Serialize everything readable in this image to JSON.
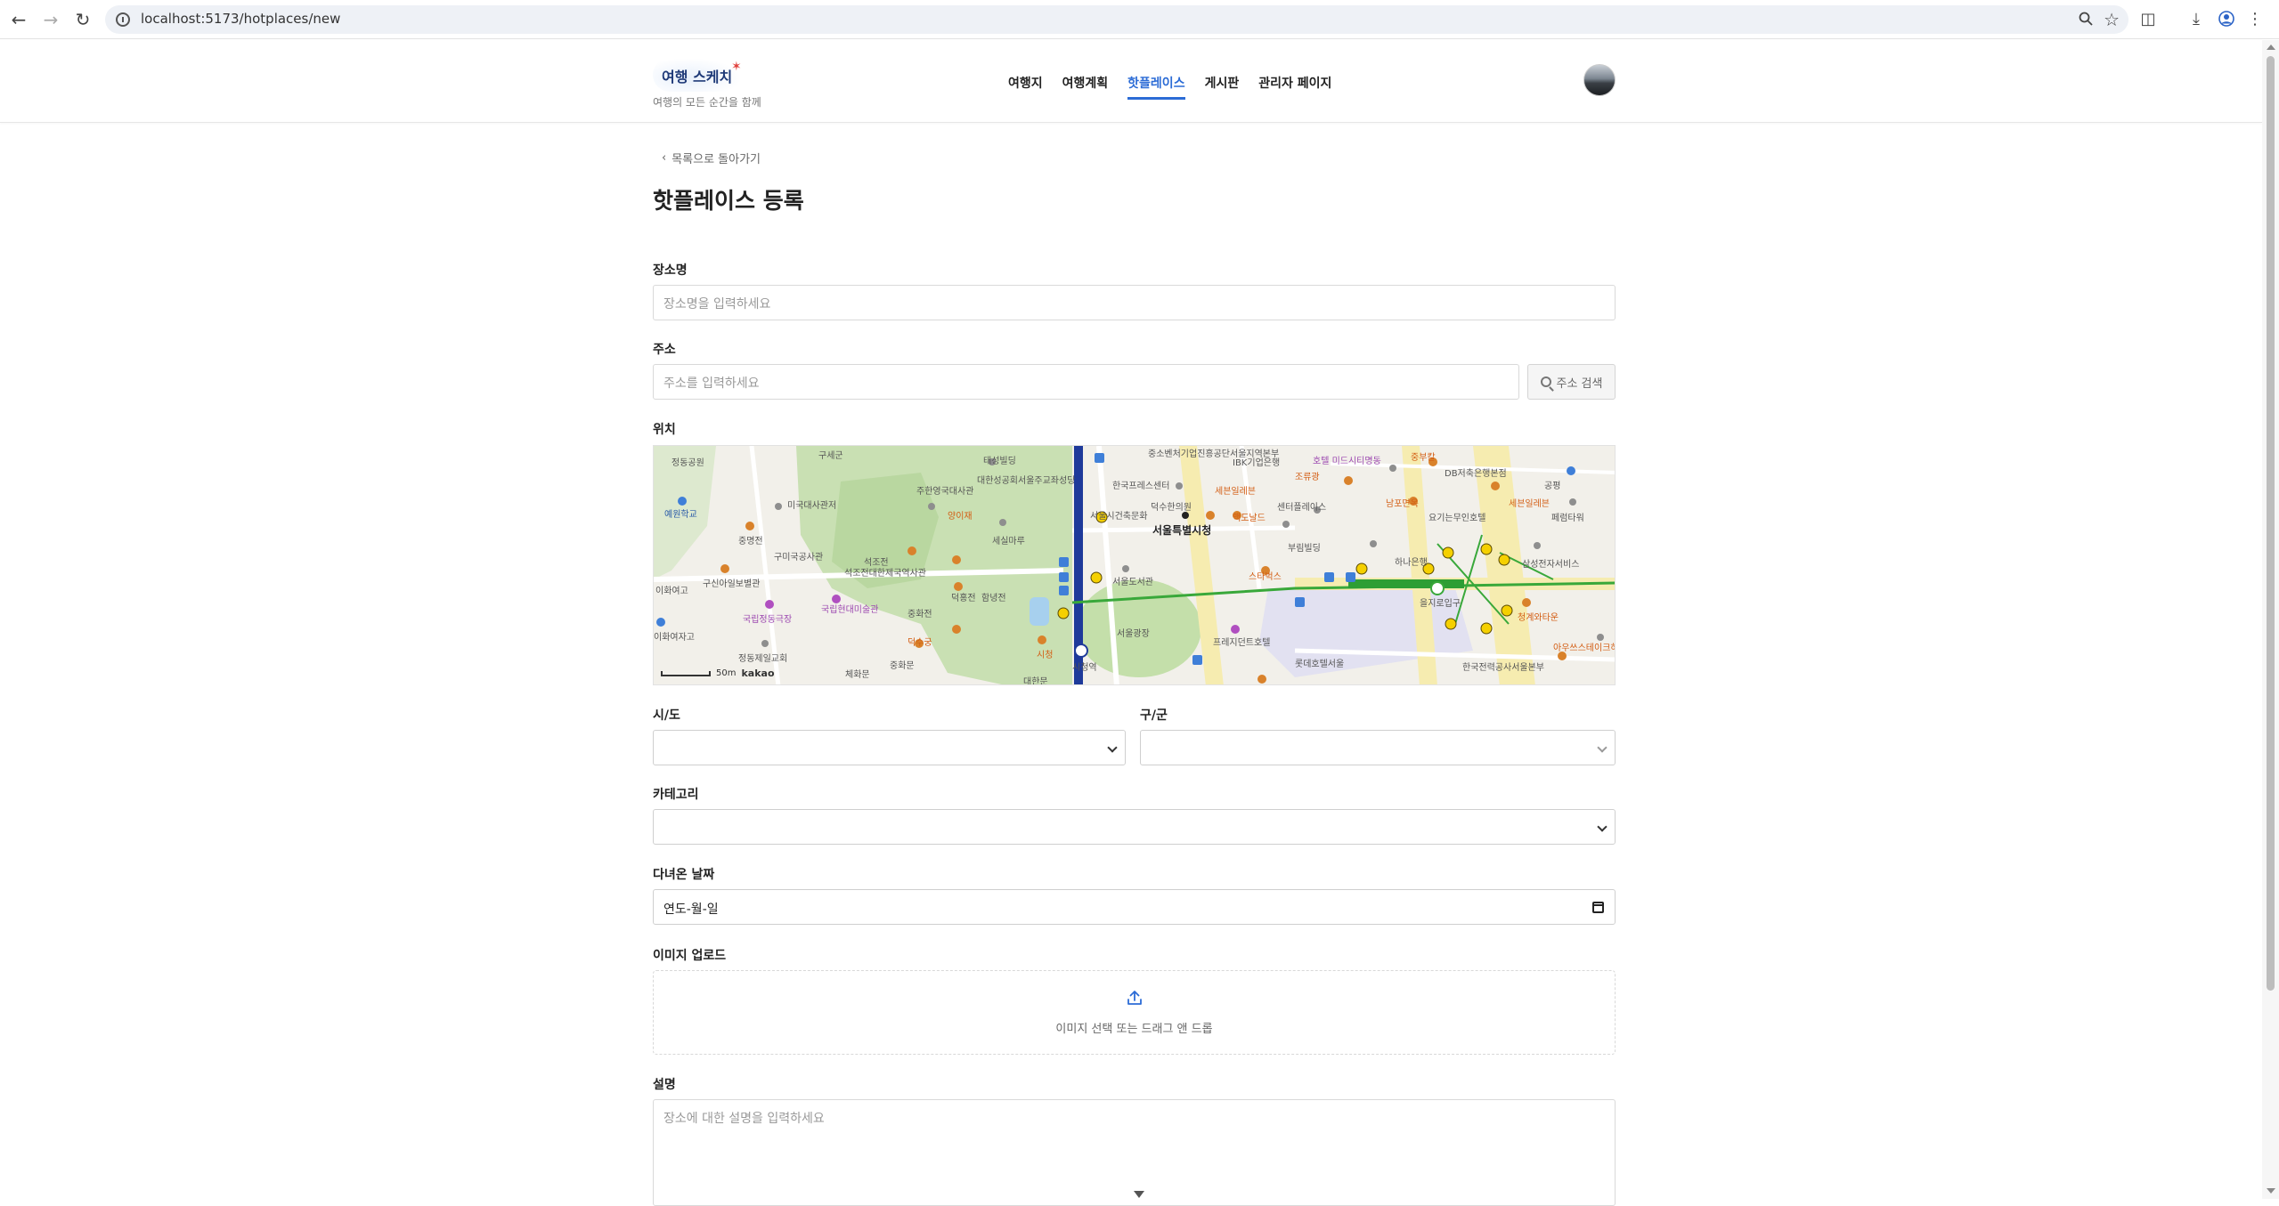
{
  "browser": {
    "url": "localhost:5173/hotplaces/new"
  },
  "site": {
    "logo_text": "여행 스케치",
    "tagline": "여행의 모든 순간을 함께",
    "nav": [
      {
        "label": "여행지",
        "active": false
      },
      {
        "label": "여행계획",
        "active": false
      },
      {
        "label": "핫플레이스",
        "active": true
      },
      {
        "label": "게시판",
        "active": false
      },
      {
        "label": "관리자 페이지",
        "active": false
      }
    ],
    "accent_color": "#2c6cd6"
  },
  "page": {
    "back_link": "목록으로 돌아가기",
    "title": "핫플레이스 등록"
  },
  "form": {
    "name": {
      "label": "장소명",
      "placeholder": "장소명을 입력하세요"
    },
    "address": {
      "label": "주소",
      "placeholder": "주소를 입력하세요",
      "button": "주소 검색"
    },
    "location": {
      "label": "위치"
    },
    "sido": {
      "label": "시/도",
      "value": ""
    },
    "gugun": {
      "label": "구/군",
      "value": ""
    },
    "category": {
      "label": "카테고리",
      "value": ""
    },
    "visit_date": {
      "label": "다녀온 날짜",
      "value": "연도-월-일"
    },
    "image": {
      "label": "이미지 업로드",
      "hint": "이미지 선택 또는 드래그 앤 드롭"
    },
    "description": {
      "label": "설명",
      "placeholder": "장소에 대한 설명을 입력하세요"
    }
  },
  "map": {
    "attribution": "kakao",
    "scale_label": "50m",
    "labels": {
      "city_hall": "서울특별시청",
      "l1": "정동공원",
      "l2": "예원학교",
      "l3": "구세군",
      "l4": "중명전",
      "l5": "구미국공사관",
      "l6": "미국대사관저",
      "l7": "주한영국대사관",
      "l8": "대한성공회서울주교좌성당",
      "l9": "태성빌딩",
      "l10": "양이재",
      "l11": "세실마루",
      "l12": "석조전",
      "l13": "석조전대한제국역사관",
      "l14": "국립현대미술관",
      "l15": "덕홍전",
      "l16": "함녕전",
      "l17": "중화전",
      "l18": "덕수궁",
      "l19": "중화문",
      "l20": "서울도서관",
      "l21": "서울광장",
      "l22": "프레지던트호텔",
      "l23": "롯데호텔서울",
      "l24": "한국전력공사서울본부",
      "l25": "하나은행",
      "l26": "삼성전자서비스",
      "l27": "청계와타운",
      "l28": "센터플레이스",
      "l29": "부림빌딩",
      "l30": "스타벅스",
      "l31": "세븐일레븐",
      "l32": "맥도날드",
      "l33": "덕수한의원",
      "l34": "IBK기업은행",
      "l35": "DB저축은행본점",
      "l36": "호텔 미드시티명동",
      "l37": "조류광",
      "l38": "남포면옥",
      "l39": "요기는무인호텔",
      "l40": "중부칼",
      "l41": "국립정동극장",
      "l42": "구신아일보별관",
      "l43": "이화여고",
      "l44": "정동제일교회",
      "l45": "대한문",
      "l46": "시청",
      "l47": "을지로입구",
      "l48": "시청역",
      "l49": "아우쓰스테이크하우스",
      "l50": "페럼타워",
      "l51": "서울시건축문화",
      "l52": "한국프레스센터",
      "l53": "중소벤처기업진흥공단서울지역본부",
      "l54": "세븐일레븐",
      "l55": "공평",
      "l56": "이화여자고",
      "l57": "체화문"
    }
  }
}
